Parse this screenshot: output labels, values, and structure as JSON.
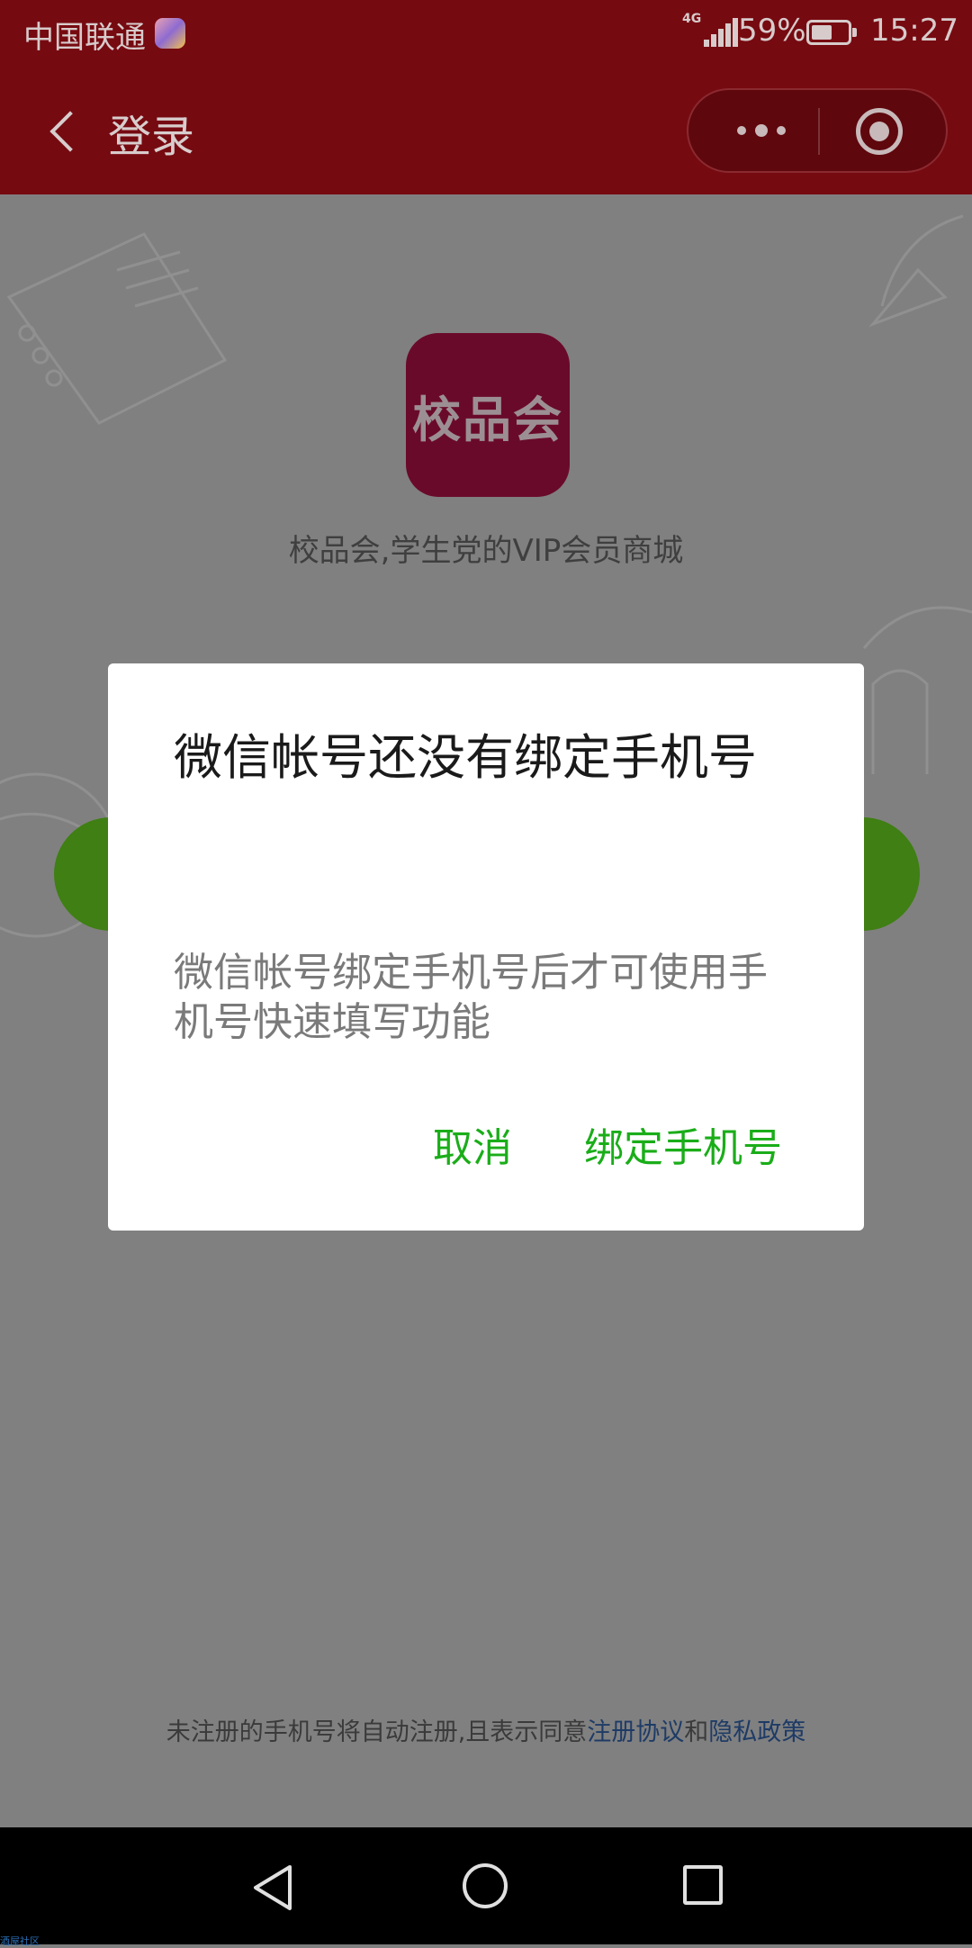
{
  "status_bar": {
    "carrier": "中国联通",
    "network": "4G",
    "battery_percent": "59%",
    "battery_level": 0.59,
    "time": "15:27"
  },
  "nav_bar": {
    "title": "登录"
  },
  "app": {
    "logo_text": "校品会",
    "description": "校品会,学生党的VIP会员商城",
    "logo_color": "#6a0a2a"
  },
  "agreement": {
    "prefix": "未注册的手机号将自动注册,且表示同意",
    "terms_link": "注册协议",
    "and": "和",
    "privacy_link": "隐私政策"
  },
  "dialog": {
    "title": "微信帐号还没有绑定手机号",
    "message": "微信帐号绑定手机号后才可使用手机号快速填写功能",
    "cancel_label": "取消",
    "confirm_label": "绑定手机号",
    "button_color": "#1aad19"
  },
  "theme": {
    "header_color": "#760a11",
    "overlay_color": "#808080"
  },
  "watermark": "酒屋社区"
}
